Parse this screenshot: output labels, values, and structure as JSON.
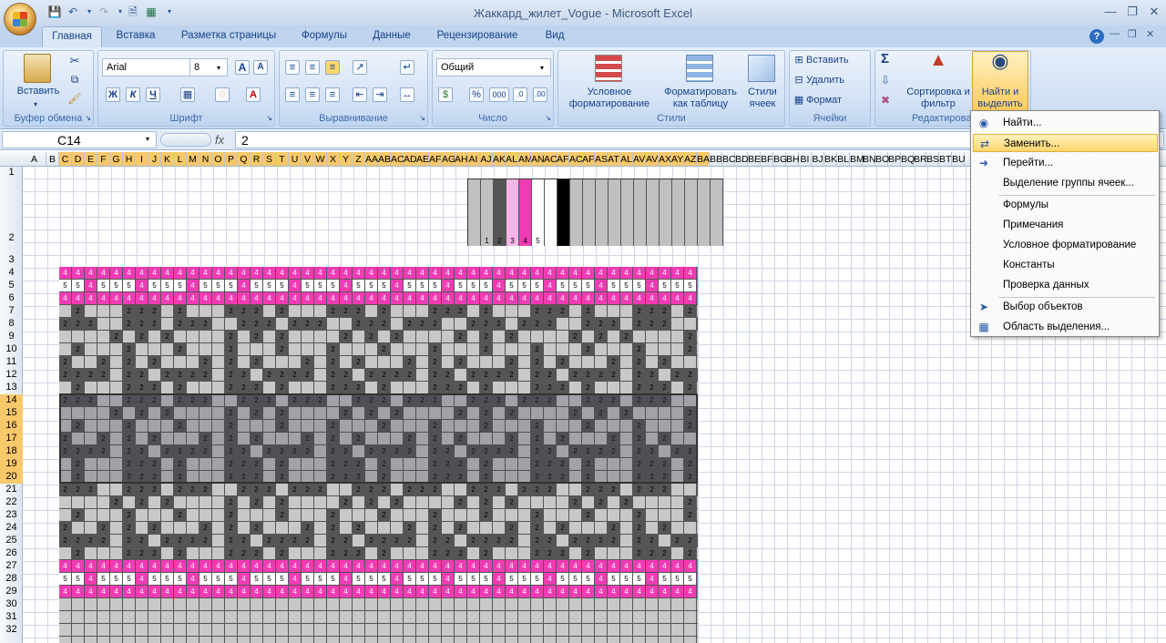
{
  "window": {
    "title": "Жаккард_жилет_Vogue - Microsoft Excel",
    "minimize_icon": "minimize-icon",
    "restore_icon": "restore-icon",
    "close_icon": "close-icon"
  },
  "qat": {
    "save_icon": "save-icon",
    "undo_icon": "undo-icon",
    "redo_icon": "redo-icon",
    "preview_icon": "print-preview-icon",
    "excel_icon": "excel-icon",
    "more_icon": "customize-qat-icon"
  },
  "tabs": [
    "Главная",
    "Вставка",
    "Разметка страницы",
    "Формулы",
    "Данные",
    "Рецензирование",
    "Вид"
  ],
  "ribbon": {
    "clipboard": {
      "label": "Буфер обмена",
      "paste": "Вставить"
    },
    "font": {
      "label": "Шрифт",
      "name": "Arial",
      "size": "8",
      "bold": "Ж",
      "italic": "К",
      "underline": "Ч"
    },
    "alignment": {
      "label": "Выравнивание"
    },
    "number": {
      "label": "Число",
      "format": "Общий",
      "percent": "%",
      "thousands": "000"
    },
    "styles": {
      "label": "Стили",
      "conditional": "Условное форматирование",
      "as_table": "Форматировать как таблицу",
      "cell_styles": "Стили ячеек"
    },
    "cells": {
      "label": "Ячейки",
      "insert": "Вставить",
      "delete": "Удалить",
      "format": "Формат"
    },
    "editing": {
      "label": "Редактирование",
      "sort": "Сортировка и фильтр",
      "find": "Найти и выделить"
    }
  },
  "formula_bar": {
    "name_box": "C14",
    "fx": "fx",
    "value": "2"
  },
  "columns": [
    "A",
    "B",
    "C",
    "D",
    "E",
    "F",
    "G",
    "H",
    "I",
    "J",
    "K",
    "L",
    "M",
    "N",
    "O",
    "P",
    "Q",
    "R",
    "S",
    "T",
    "U",
    "V",
    "W",
    "X",
    "Y",
    "Z",
    "AA",
    "AB",
    "AC",
    "AD",
    "AE",
    "AF",
    "AG",
    "AH",
    "AI",
    "AJ",
    "AK",
    "AL",
    "AM",
    "AN",
    "AC",
    "AF",
    "AC",
    "AF",
    "AS",
    "AT",
    "AL",
    "AV",
    "AV",
    "AX",
    "AY",
    "AZ",
    "BA",
    "BB",
    "BC",
    "BD",
    "BE",
    "BF",
    "BG",
    "BH",
    "BI",
    "BJ",
    "BK",
    "BL",
    "BM",
    "BN",
    "BO",
    "BP",
    "BQ",
    "BR",
    "BS",
    "BT",
    "BU"
  ],
  "rows": [
    "1",
    "2",
    "3",
    "4",
    "5",
    "6",
    "7",
    "8",
    "9",
    "10",
    "11",
    "12",
    "13",
    "14",
    "15",
    "16",
    "17",
    "18",
    "19",
    "20",
    "21",
    "22",
    "23",
    "24",
    "25",
    "26",
    "27",
    "28",
    "29",
    "30",
    "31",
    "32"
  ],
  "palette": [
    {
      "color": "#c0c0c0",
      "label": ""
    },
    {
      "color": "#c0c0c0",
      "label": "1"
    },
    {
      "color": "#555555",
      "label": "2"
    },
    {
      "color": "#f4b6e6",
      "label": "3"
    },
    {
      "color": "#f03cb4",
      "label": "4"
    },
    {
      "color": "#ffffff",
      "label": "5"
    },
    {
      "color": "#ffffff",
      "label": ""
    },
    {
      "color": "#000000",
      "label": ""
    },
    {
      "color": "#c0c0c0",
      "label": ""
    },
    {
      "color": "#c0c0c0",
      "label": ""
    },
    {
      "color": "#c0c0c0",
      "label": ""
    },
    {
      "color": "#c0c0c0",
      "label": ""
    },
    {
      "color": "#c0c0c0",
      "label": ""
    },
    {
      "color": "#c0c0c0",
      "label": ""
    },
    {
      "color": "#c0c0c0",
      "label": ""
    },
    {
      "color": "#c0c0c0",
      "label": ""
    },
    {
      "color": "#c0c0c0",
      "label": ""
    },
    {
      "color": "#c0c0c0",
      "label": ""
    },
    {
      "color": "#c0c0c0",
      "label": ""
    },
    {
      "color": "#c0c0c0",
      "label": ""
    }
  ],
  "grid_pattern": {
    "colors": {
      "4": "#f03cb4",
      "5": "#ffffff",
      "2": "#555555",
      "1": "#c8c8c8"
    },
    "rows": [
      "4444444444444444444444444444444444444444444444444444",
      "5545554555455545554555455545554555455545554555455545",
      "4444444444444444444444444444444444444444444444444444",
      "1211122212111222121112221211122212111222121112221212",
      "2221122212221122212221122212221122212221122212221122",
      "1111212121111212121111212121111212121111212121111212",
      "1211121112111211121112111211121112111211121112111212",
      "2112121211121212111212121112121211121212111212121112",
      "2222122122221221222212212222122122221221222212212222",
      "1211122212111222121112221211122212111222121112221212",
      "2221122212221122212221122212221122212221122212221122",
      "1111212121111212121111212121111212121111212121111212",
      "1211121112111211121112111211121112111211121112111212",
      "2112121211121212111212121112121211121212111212121112",
      "2222122122221221222212212222122122221221222212212222",
      "1211122212111222121112221211122212111222121112221212",
      "1211122212111222121112221211122212111222121112221212",
      "2221122212221122212221122212221122212221122212221122",
      "1111212121111212121111212121111212121111212121111212",
      "1211121112111211121112111211121112111211121112111212",
      "2112121211121212111212121112121211121212111212121112",
      "2222122122221221222212212222122122221221222212212222",
      "1211122212111222121112221211122212111222121112221212",
      "4444444444444444444444444444444444444444444444444444",
      "5545554555455545554555455545554555455545554555455545",
      "4444444444444444444444444444444444444444444444444444",
      "1111111111111111111111111111111111111111111111111111",
      "1111111111111111111111111111111111111111111111111111",
      "1111111111111111111111111111111111111111111111111111",
      "1111111111111111111111111111111111111111111111111111"
    ]
  },
  "menu": {
    "items": [
      {
        "label": "Найти...",
        "icon": "binoculars-icon"
      },
      {
        "label": "Заменить...",
        "icon": "replace-icon"
      },
      {
        "label": "Перейти...",
        "icon": "arrow-right-icon"
      },
      {
        "label": "Выделение группы ячеек...",
        "icon": ""
      },
      {
        "label": "Формулы",
        "icon": ""
      },
      {
        "label": "Примечания",
        "icon": ""
      },
      {
        "label": "Условное форматирование",
        "icon": ""
      },
      {
        "label": "Константы",
        "icon": ""
      },
      {
        "label": "Проверка данных",
        "icon": ""
      },
      {
        "label": "Выбор объектов",
        "icon": "cursor-icon"
      },
      {
        "label": "Область выделения...",
        "icon": "selection-pane-icon"
      }
    ]
  }
}
